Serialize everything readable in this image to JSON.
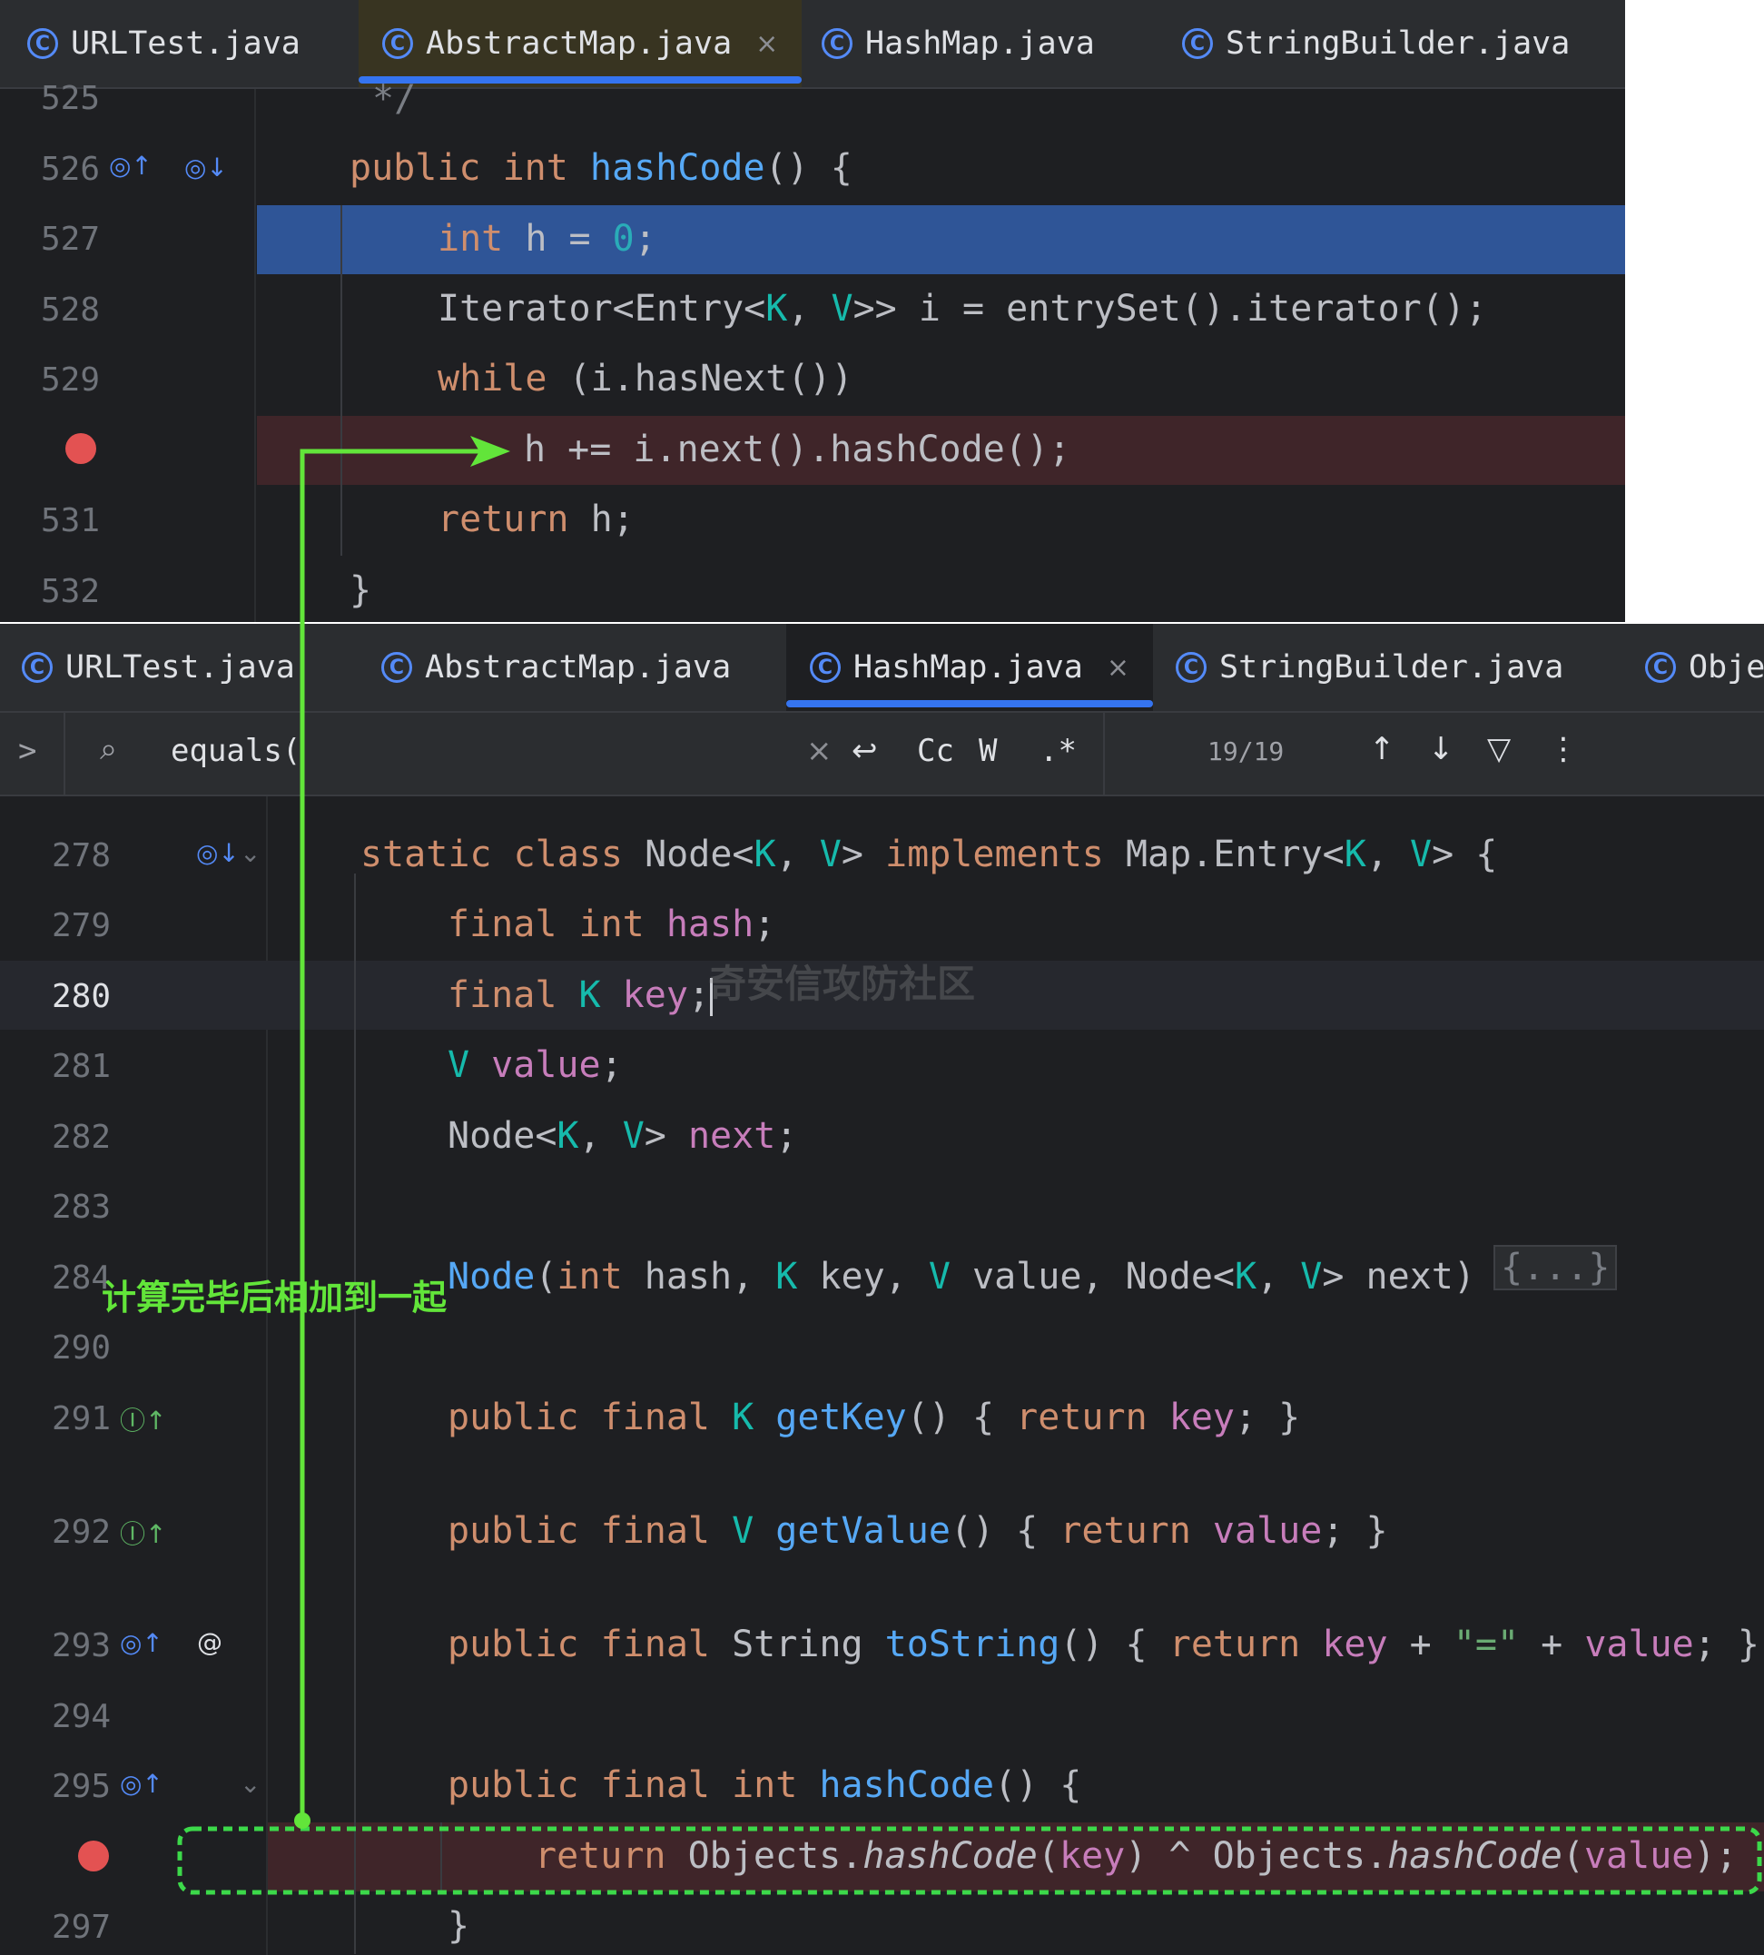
{
  "top": {
    "tabs": [
      {
        "label": "URLTest.java"
      },
      {
        "label": "AbstractMap.java"
      },
      {
        "label": "HashMap.java"
      },
      {
        "label": "StringBuilder.java"
      }
    ],
    "active_tab_close": "×",
    "lines": {
      "l525": "525",
      "l526": "526",
      "l527": "527",
      "l528": "528",
      "l529": "529",
      "l531": "531",
      "l532": "532"
    }
  },
  "bottom": {
    "tabs": [
      {
        "label": "URLTest.java"
      },
      {
        "label": "AbstractMap.java"
      },
      {
        "label": "HashMap.java"
      },
      {
        "label": "StringBuilder.java"
      },
      {
        "label": "Obje"
      }
    ],
    "active_tab_close": "×",
    "search": {
      "expand": ">",
      "query": "equals(",
      "clear": "×",
      "case": "Cc",
      "words": "W",
      "regex": ".*",
      "count": "19/19",
      "up": "↑",
      "down": "↓",
      "more": "⋮"
    },
    "lines": {
      "l278": "278",
      "l279": "279",
      "l280": "280",
      "l281": "281",
      "l282": "282",
      "l283": "283",
      "l284": "284",
      "l290": "290",
      "l291": "291",
      "l292": "292",
      "l293": "293",
      "l294": "294",
      "l295": "295",
      "l297": "297"
    },
    "fold_placeholder": "{...}"
  },
  "annotation": "计算完毕后相加到一起",
  "watermark": "奇安信攻防社区",
  "colors": {
    "arrow": "#62e53a",
    "selection": "#2f5597",
    "breakpoint_line": "#3f2529",
    "breakpoint": "#e35252"
  }
}
